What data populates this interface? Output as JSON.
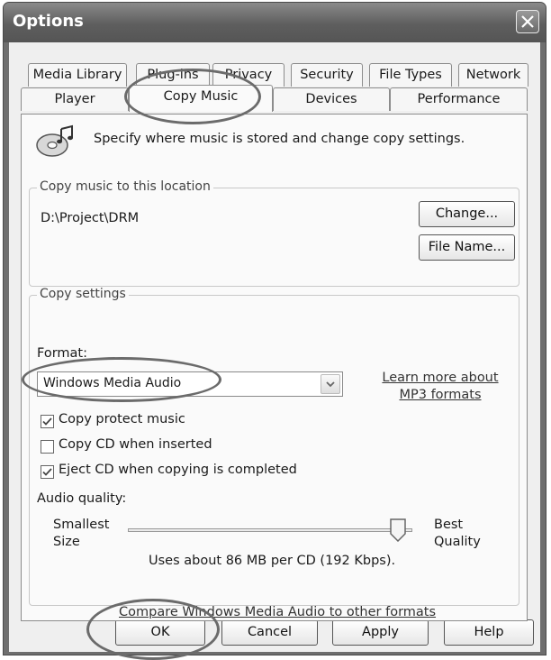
{
  "window": {
    "title": "Options"
  },
  "tabs": {
    "row1": [
      "Media Library",
      "Plug-ins",
      "Privacy",
      "Security",
      "File Types",
      "Network"
    ],
    "row2": [
      "Player",
      "Copy Music",
      "Devices",
      "Performance"
    ],
    "active": "Copy Music"
  },
  "panel": {
    "description": "Specify where music is stored and change copy settings.",
    "location_group": {
      "label": "Copy music to this location",
      "path": "D:\\Project\\DRM",
      "change_button": "Change...",
      "filename_button": "File Name..."
    },
    "settings_group": {
      "label": "Copy settings",
      "format_label": "Format:",
      "format_value": "Windows Media Audio",
      "learn_more_link": [
        "Learn more about",
        "MP3 formats"
      ],
      "checkboxes": [
        {
          "label": "Copy protect music",
          "checked": true
        },
        {
          "label": "Copy CD when inserted",
          "checked": false
        },
        {
          "label": "Eject CD when copying is completed",
          "checked": true
        }
      ],
      "audio_quality_label": "Audio quality:",
      "slider_min_label": [
        "Smallest",
        "Size"
      ],
      "slider_max_label": [
        "Best",
        "Quality"
      ],
      "slider_value_fraction": 0.95,
      "usage_text": "Uses about 86 MB per CD (192 Kbps).",
      "compare_link": "Compare Windows Media Audio to other formats"
    }
  },
  "footer": {
    "ok": "OK",
    "cancel": "Cancel",
    "apply": "Apply",
    "help": "Help"
  },
  "colors": {
    "titlebar": "#6e6e6e",
    "annotation_ring": "#6b6b6b"
  }
}
